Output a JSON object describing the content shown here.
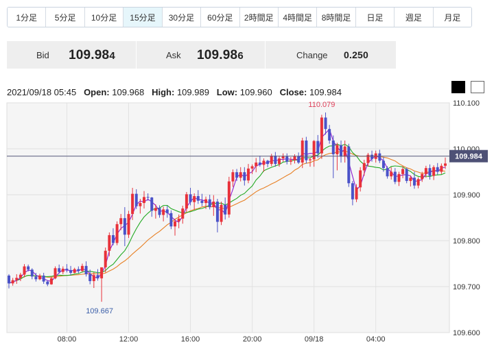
{
  "tabs": [
    "1分足",
    "5分足",
    "10分足",
    "15分足",
    "30分足",
    "60分足",
    "2時間足",
    "4時間足",
    "8時間足",
    "日足",
    "週足",
    "月足"
  ],
  "active_tab": "15分足",
  "quote": {
    "bid_label": "Bid",
    "bid_main": "109.98",
    "bid_last": "4",
    "ask_label": "Ask",
    "ask_main": "109.98",
    "ask_last": "6",
    "change_label": "Change",
    "change_value": "0.250"
  },
  "ohlc": {
    "datetime": "2021/09/18 05:45",
    "open_label": "Open:",
    "open": "109.968",
    "high_label": "High:",
    "high": "109.989",
    "low_label": "Low:",
    "low": "109.960",
    "close_label": "Close:",
    "close": "109.984"
  },
  "colors": {
    "up": "#e8313a",
    "down": "#4a52c8",
    "ma_short": "#8c1bd0",
    "ma_mid": "#22aa22",
    "ma_long": "#e77f23",
    "price_line": "#55567a",
    "price_label_bg": "#4e5176"
  },
  "chart_data": {
    "type": "candlestick",
    "title": "",
    "ylim": [
      109.6,
      110.1
    ],
    "y_ticks": [
      "110.100",
      "110.000",
      "109.900",
      "109.800",
      "109.700",
      "109.600"
    ],
    "x_ticks": [
      "08:00",
      "12:00",
      "16:00",
      "20:00",
      "09/18",
      "04:00"
    ],
    "current_price": "109.984",
    "high_annotation": "110.079",
    "low_annotation": "109.667",
    "candles": [
      [
        109.724,
        109.727,
        109.696,
        109.707
      ],
      [
        109.707,
        109.719,
        109.702,
        109.714
      ],
      [
        109.714,
        109.727,
        109.706,
        109.719
      ],
      [
        109.719,
        109.73,
        109.712,
        109.726
      ],
      [
        109.726,
        109.749,
        109.72,
        109.744
      ],
      [
        109.744,
        109.748,
        109.733,
        109.737
      ],
      [
        109.737,
        109.74,
        109.716,
        109.722
      ],
      [
        109.722,
        109.73,
        109.711,
        109.716
      ],
      [
        109.716,
        109.728,
        109.714,
        109.724
      ],
      [
        109.724,
        109.73,
        109.706,
        109.711
      ],
      [
        109.711,
        109.713,
        109.701,
        109.705
      ],
      [
        109.705,
        109.722,
        109.704,
        109.718
      ],
      [
        109.718,
        109.744,
        109.716,
        109.74
      ],
      [
        109.74,
        109.748,
        109.728,
        109.732
      ],
      [
        109.732,
        109.744,
        109.727,
        109.739
      ],
      [
        109.739,
        109.749,
        109.731,
        109.736
      ],
      [
        109.736,
        109.745,
        109.725,
        109.73
      ],
      [
        109.73,
        109.741,
        109.729,
        109.738
      ],
      [
        109.738,
        109.744,
        109.729,
        109.734
      ],
      [
        109.734,
        109.75,
        109.732,
        109.745
      ],
      [
        109.745,
        109.755,
        109.722,
        109.727
      ],
      [
        109.727,
        109.737,
        109.705,
        109.712
      ],
      [
        109.712,
        109.731,
        109.697,
        109.725
      ],
      [
        109.725,
        109.738,
        109.713,
        109.718
      ],
      [
        109.718,
        109.724,
        109.667,
        109.742
      ],
      [
        109.742,
        109.785,
        109.731,
        109.778
      ],
      [
        109.778,
        109.818,
        109.766,
        109.812
      ],
      [
        109.812,
        109.827,
        109.79,
        109.795
      ],
      [
        109.795,
        109.842,
        109.79,
        109.836
      ],
      [
        109.836,
        109.858,
        109.823,
        109.849
      ],
      [
        109.849,
        109.873,
        109.788,
        109.813
      ],
      [
        109.813,
        109.865,
        109.806,
        109.858
      ],
      [
        109.858,
        109.915,
        109.845,
        109.902
      ],
      [
        109.902,
        109.912,
        109.869,
        109.875
      ],
      [
        109.875,
        109.891,
        109.859,
        109.882
      ],
      [
        109.882,
        109.908,
        109.87,
        109.895
      ],
      [
        109.895,
        109.903,
        109.887,
        109.894
      ],
      [
        109.894,
        109.895,
        109.852,
        109.865
      ],
      [
        109.865,
        109.879,
        109.848,
        109.871
      ],
      [
        109.871,
        109.877,
        109.85,
        109.856
      ],
      [
        109.856,
        109.874,
        109.842,
        109.868
      ],
      [
        109.868,
        109.876,
        109.85,
        109.86
      ],
      [
        109.86,
        109.866,
        109.825,
        109.831
      ],
      [
        109.831,
        109.848,
        109.811,
        109.842
      ],
      [
        109.842,
        109.857,
        109.827,
        109.848
      ],
      [
        109.848,
        109.876,
        109.837,
        109.87
      ],
      [
        109.87,
        109.906,
        109.862,
        109.901
      ],
      [
        109.901,
        109.915,
        109.877,
        109.884
      ],
      [
        109.884,
        109.903,
        109.867,
        109.897
      ],
      [
        109.897,
        109.91,
        109.88,
        109.887
      ],
      [
        109.887,
        109.902,
        109.875,
        109.882
      ],
      [
        109.882,
        109.896,
        109.869,
        109.89
      ],
      [
        109.89,
        109.9,
        109.868,
        109.873
      ],
      [
        109.873,
        109.899,
        109.854,
        109.885
      ],
      [
        109.885,
        109.891,
        109.818,
        109.841
      ],
      [
        109.841,
        109.885,
        109.834,
        109.878
      ],
      [
        109.878,
        109.894,
        109.846,
        109.857
      ],
      [
        109.857,
        109.939,
        109.85,
        109.929
      ],
      [
        109.929,
        109.955,
        109.917,
        109.949
      ],
      [
        109.949,
        109.956,
        109.93,
        109.937
      ],
      [
        109.937,
        109.96,
        109.929,
        109.949
      ],
      [
        109.949,
        109.96,
        109.92,
        109.931
      ],
      [
        109.931,
        109.967,
        109.925,
        109.957
      ],
      [
        109.957,
        109.966,
        109.945,
        109.962
      ],
      [
        109.962,
        109.98,
        109.949,
        109.97
      ],
      [
        109.97,
        109.985,
        109.961,
        109.965
      ],
      [
        109.965,
        109.979,
        109.95,
        109.974
      ],
      [
        109.974,
        109.976,
        109.96,
        109.967
      ],
      [
        109.967,
        109.989,
        109.962,
        109.985
      ],
      [
        109.985,
        109.993,
        109.961,
        109.967
      ],
      [
        109.967,
        109.985,
        109.961,
        109.979
      ],
      [
        109.979,
        109.99,
        109.972,
        109.984
      ],
      [
        109.984,
        109.99,
        109.966,
        109.972
      ],
      [
        109.972,
        109.982,
        109.965,
        109.975
      ],
      [
        109.975,
        109.988,
        109.968,
        109.984
      ],
      [
        109.984,
        109.992,
        109.967,
        109.97
      ],
      [
        109.97,
        110.024,
        109.958,
        110.018
      ],
      [
        110.018,
        110.026,
        109.968,
        109.975
      ],
      [
        109.975,
        109.981,
        109.961,
        109.977
      ],
      [
        109.977,
        110.019,
        109.961,
        110.017
      ],
      [
        110.017,
        110.03,
        109.98,
        109.99
      ],
      [
        109.99,
        110.074,
        109.978,
        110.068
      ],
      [
        110.068,
        110.079,
        110.031,
        110.043
      ],
      [
        110.043,
        110.052,
        110.011,
        110.018
      ],
      [
        110.018,
        110.029,
        109.936,
        109.988
      ],
      [
        109.988,
        110.013,
        109.953,
        110.008
      ],
      [
        110.008,
        110.018,
        109.97,
        109.983
      ],
      [
        109.983,
        110.018,
        109.97,
        110.005
      ],
      [
        110.005,
        110.011,
        109.917,
        109.925
      ],
      [
        109.925,
        109.93,
        109.877,
        109.89
      ],
      [
        109.89,
        109.923,
        109.884,
        109.916
      ],
      [
        109.916,
        109.96,
        109.907,
        109.953
      ],
      [
        109.953,
        109.976,
        109.941,
        109.969
      ],
      [
        109.969,
        109.991,
        109.962,
        109.987
      ],
      [
        109.987,
        109.996,
        109.972,
        109.978
      ],
      [
        109.978,
        109.996,
        109.97,
        109.99
      ],
      [
        109.99,
        109.998,
        109.969,
        109.974
      ],
      [
        109.974,
        109.982,
        109.95,
        109.958
      ],
      [
        109.958,
        109.962,
        109.935,
        109.94
      ],
      [
        109.94,
        109.96,
        109.933,
        109.95
      ],
      [
        109.95,
        109.958,
        109.923,
        109.928
      ],
      [
        109.928,
        109.95,
        109.919,
        109.945
      ],
      [
        109.945,
        109.962,
        109.936,
        109.956
      ],
      [
        109.956,
        109.959,
        109.925,
        109.93
      ],
      [
        109.93,
        109.942,
        109.918,
        109.937
      ],
      [
        109.937,
        109.95,
        109.913,
        109.92
      ],
      [
        109.92,
        109.938,
        109.914,
        109.934
      ],
      [
        109.934,
        109.95,
        109.928,
        109.945
      ],
      [
        109.945,
        109.963,
        109.937,
        109.958
      ],
      [
        109.958,
        109.966,
        109.933,
        109.941
      ],
      [
        109.941,
        109.964,
        109.932,
        109.96
      ],
      [
        109.96,
        109.969,
        109.944,
        109.95
      ],
      [
        109.95,
        109.968,
        109.945,
        109.963
      ],
      [
        109.963,
        109.981,
        109.956,
        109.968
      ]
    ]
  }
}
